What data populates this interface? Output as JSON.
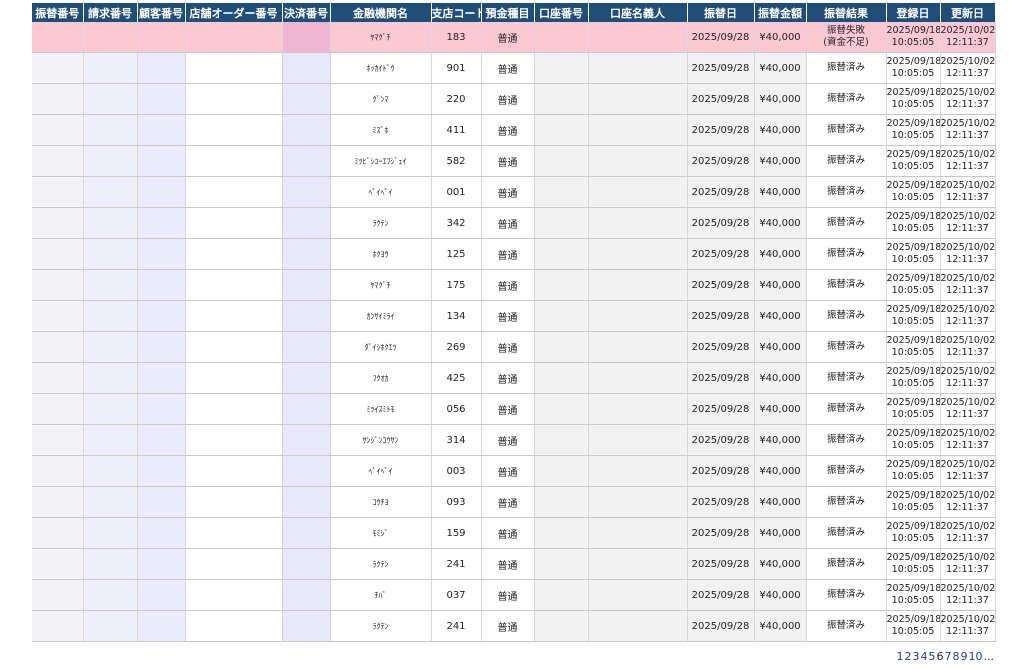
{
  "headers": [
    "振替番号",
    "請求番号",
    "顧客番号",
    "店舗オーダー番号",
    "決済番号",
    "金融機関名",
    "支店コード",
    "預金種目",
    "口座番号",
    "口座名義人",
    "振替日",
    "振替金額",
    "振替結果",
    "登録日",
    "更新日"
  ],
  "rows": [
    {
      "bank": "ﾔﾏｸﾞﾁ",
      "branch": "183",
      "type": "普通",
      "date": "2025/09/28",
      "amount": "¥40,000",
      "result": "振替失敗\n(資金不足)",
      "reg_d": "2025/09/18",
      "reg_t": "10:05:05",
      "upd_d": "2025/10/02",
      "upd_t": "12:11:37",
      "highlight": true
    },
    {
      "bank": "ﾎｯｶｲﾄﾞｳ",
      "branch": "901",
      "type": "普通",
      "date": "2025/09/28",
      "amount": "¥40,000",
      "result": "振替済み",
      "reg_d": "2025/09/18",
      "reg_t": "10:05:05",
      "upd_d": "2025/10/02",
      "upd_t": "12:11:37",
      "highlight": false
    },
    {
      "bank": "ｸﾞﾝﾏ",
      "branch": "220",
      "type": "普通",
      "date": "2025/09/28",
      "amount": "¥40,000",
      "result": "振替済み",
      "reg_d": "2025/09/18",
      "reg_t": "10:05:05",
      "upd_d": "2025/10/02",
      "upd_t": "12:11:37",
      "highlight": false
    },
    {
      "bank": "ﾐｽﾞﾎ",
      "branch": "411",
      "type": "普通",
      "date": "2025/09/28",
      "amount": "¥40,000",
      "result": "振替済み",
      "reg_d": "2025/09/18",
      "reg_t": "10:05:05",
      "upd_d": "2025/10/02",
      "upd_t": "12:11:37",
      "highlight": false
    },
    {
      "bank": "ﾐﾂﾋﾞｼﾕｰｴﾌｼﾞｪｲ",
      "branch": "582",
      "type": "普通",
      "date": "2025/09/28",
      "amount": "¥40,000",
      "result": "振替済み",
      "reg_d": "2025/09/18",
      "reg_t": "10:05:05",
      "upd_d": "2025/10/02",
      "upd_t": "12:11:37",
      "highlight": false
    },
    {
      "bank": "ﾍﾟｲﾍﾟｲ",
      "branch": "001",
      "type": "普通",
      "date": "2025/09/28",
      "amount": "¥40,000",
      "result": "振替済み",
      "reg_d": "2025/09/18",
      "reg_t": "10:05:05",
      "upd_d": "2025/10/02",
      "upd_t": "12:11:37",
      "highlight": false
    },
    {
      "bank": "ﾗｸﾃﾝ",
      "branch": "342",
      "type": "普通",
      "date": "2025/09/28",
      "amount": "¥40,000",
      "result": "振替済み",
      "reg_d": "2025/09/18",
      "reg_t": "10:05:05",
      "upd_d": "2025/10/02",
      "upd_t": "12:11:37",
      "highlight": false
    },
    {
      "bank": "ﾎｸﾖｳ",
      "branch": "125",
      "type": "普通",
      "date": "2025/09/28",
      "amount": "¥40,000",
      "result": "振替済み",
      "reg_d": "2025/09/18",
      "reg_t": "10:05:05",
      "upd_d": "2025/10/02",
      "upd_t": "12:11:37",
      "highlight": false
    },
    {
      "bank": "ﾔﾏｸﾞﾁ",
      "branch": "175",
      "type": "普通",
      "date": "2025/09/28",
      "amount": "¥40,000",
      "result": "振替済み",
      "reg_d": "2025/09/18",
      "reg_t": "10:05:05",
      "upd_d": "2025/10/02",
      "upd_t": "12:11:37",
      "highlight": false
    },
    {
      "bank": "ｶﾝｻｲﾐﾗｲ",
      "branch": "134",
      "type": "普通",
      "date": "2025/09/28",
      "amount": "¥40,000",
      "result": "振替済み",
      "reg_d": "2025/09/18",
      "reg_t": "10:05:05",
      "upd_d": "2025/10/02",
      "upd_t": "12:11:37",
      "highlight": false
    },
    {
      "bank": "ﾀﾞｲｼﾎｸｴﾂ",
      "branch": "269",
      "type": "普通",
      "date": "2025/09/28",
      "amount": "¥40,000",
      "result": "振替済み",
      "reg_d": "2025/09/18",
      "reg_t": "10:05:05",
      "upd_d": "2025/10/02",
      "upd_t": "12:11:37",
      "highlight": false
    },
    {
      "bank": "ﾌｸｵｶ",
      "branch": "425",
      "type": "普通",
      "date": "2025/09/28",
      "amount": "¥40,000",
      "result": "振替済み",
      "reg_d": "2025/09/18",
      "reg_t": "10:05:05",
      "upd_d": "2025/10/02",
      "upd_t": "12:11:37",
      "highlight": false
    },
    {
      "bank": "ﾐﾂｲｽﾐﾄﾓ",
      "branch": "056",
      "type": "普通",
      "date": "2025/09/28",
      "amount": "¥40,000",
      "result": "振替済み",
      "reg_d": "2025/09/18",
      "reg_t": "10:05:05",
      "upd_d": "2025/10/02",
      "upd_t": "12:11:37",
      "highlight": false
    },
    {
      "bank": "ｻﾝｼﾞﾝｺｳｻﾝ",
      "branch": "314",
      "type": "普通",
      "date": "2025/09/28",
      "amount": "¥40,000",
      "result": "振替済み",
      "reg_d": "2025/09/18",
      "reg_t": "10:05:05",
      "upd_d": "2025/10/02",
      "upd_t": "12:11:37",
      "highlight": false
    },
    {
      "bank": "ﾍﾟｲﾍﾟｲ",
      "branch": "003",
      "type": "普通",
      "date": "2025/09/28",
      "amount": "¥40,000",
      "result": "振替済み",
      "reg_d": "2025/09/18",
      "reg_t": "10:05:05",
      "upd_d": "2025/10/02",
      "upd_t": "12:11:37",
      "highlight": false
    },
    {
      "bank": "ｺｳﾁﾖ",
      "branch": "093",
      "type": "普通",
      "date": "2025/09/28",
      "amount": "¥40,000",
      "result": "振替済み",
      "reg_d": "2025/09/18",
      "reg_t": "10:05:05",
      "upd_d": "2025/10/02",
      "upd_t": "12:11:37",
      "highlight": false
    },
    {
      "bank": "ﾓﾐｼﾞ",
      "branch": "159",
      "type": "普通",
      "date": "2025/09/28",
      "amount": "¥40,000",
      "result": "振替済み",
      "reg_d": "2025/09/18",
      "reg_t": "10:05:05",
      "upd_d": "2025/10/02",
      "upd_t": "12:11:37",
      "highlight": false
    },
    {
      "bank": "ﾗｸﾃﾝ",
      "branch": "241",
      "type": "普通",
      "date": "2025/09/28",
      "amount": "¥40,000",
      "result": "振替済み",
      "reg_d": "2025/09/18",
      "reg_t": "10:05:05",
      "upd_d": "2025/10/02",
      "upd_t": "12:11:37",
      "highlight": false
    },
    {
      "bank": "ﾁﾊﾞ",
      "branch": "037",
      "type": "普通",
      "date": "2025/09/28",
      "amount": "¥40,000",
      "result": "振替済み",
      "reg_d": "2025/09/18",
      "reg_t": "10:05:05",
      "upd_d": "2025/10/02",
      "upd_t": "12:11:37",
      "highlight": false
    },
    {
      "bank": "ﾗｸﾃﾝ",
      "branch": "241",
      "type": "普通",
      "date": "2025/09/28",
      "amount": "¥40,000",
      "result": "振替済み",
      "reg_d": "2025/09/18",
      "reg_t": "10:05:05",
      "upd_d": "2025/10/02",
      "upd_t": "12:11:37",
      "highlight": false
    }
  ],
  "pagination": {
    "pages": [
      "1",
      "2",
      "3",
      "4",
      "5",
      "6",
      "7",
      "8",
      "9",
      "10",
      "..."
    ],
    "current": "6"
  },
  "colors": {
    "header_bg": "#1f4e79",
    "highlight_row": "#fbc8d4",
    "link": "#1a3b9c"
  }
}
